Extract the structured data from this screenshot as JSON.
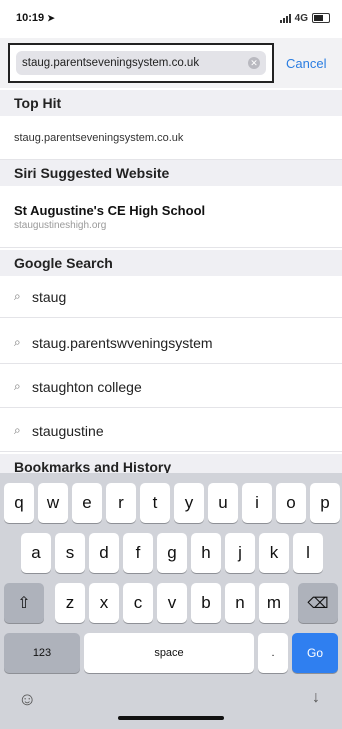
{
  "status_bar": {
    "time": "10:19",
    "network": "4G"
  },
  "search": {
    "value": "staug.parentseveningsystem.co.uk",
    "cancel_label": "Cancel"
  },
  "sections": {
    "top_hit": {
      "header": "Top Hit",
      "url": "staug.parentseveningsystem.co.uk"
    },
    "siri": {
      "header": "Siri Suggested Website",
      "title": "St Augustine's CE High School",
      "subtitle": "staugustineshigh.org"
    },
    "google": {
      "header": "Google Search",
      "items": [
        "staug",
        "staug.parentswveningsystem",
        "staughton college",
        "staugustine"
      ]
    },
    "bookmarks": {
      "header": "Bookmarks and History"
    }
  },
  "keyboard": {
    "row1": [
      "q",
      "w",
      "e",
      "r",
      "t",
      "y",
      "u",
      "i",
      "o",
      "p"
    ],
    "row2": [
      "a",
      "s",
      "d",
      "f",
      "g",
      "h",
      "j",
      "k",
      "l"
    ],
    "row3": [
      "z",
      "x",
      "c",
      "v",
      "b",
      "n",
      "m"
    ],
    "numbers_label": "123",
    "space_label": "space",
    "period_label": ".",
    "go_label": "Go"
  },
  "icons": {
    "shift": "shift-icon",
    "delete": "delete-icon",
    "emoji": "emoji-icon",
    "mic": "microphone-icon",
    "search": "search-icon",
    "location": "location-arrow-icon"
  },
  "colors": {
    "accent": "#2a7de1",
    "go_key": "#2f7ff0"
  }
}
